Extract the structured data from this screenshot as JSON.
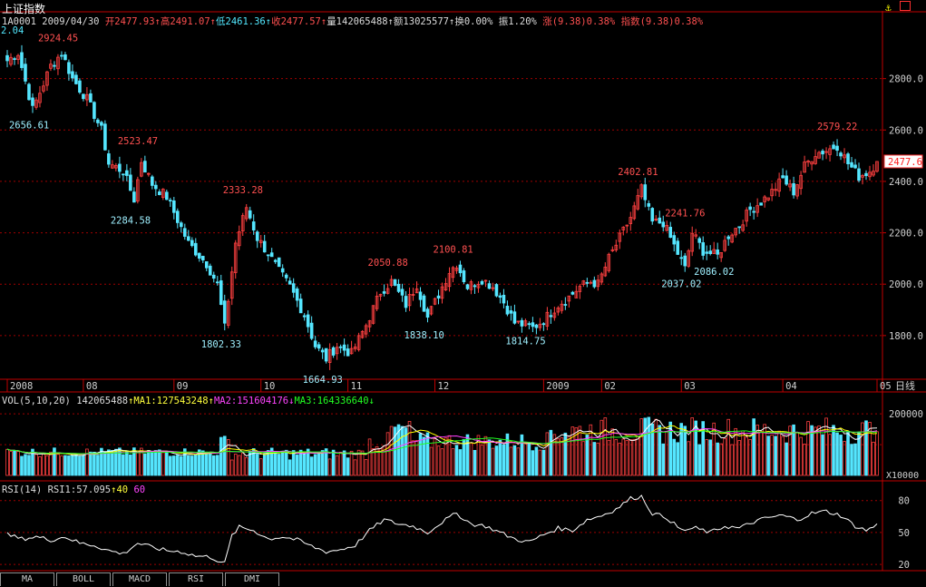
{
  "header": {
    "title": "上证指数",
    "code": "1A0001",
    "date": "2009/04/30",
    "open": "开2477.93",
    "high": "高2491.07",
    "low": "低2461.36",
    "close": "收2477.57",
    "volume": "量142065488",
    "amount": "额13025577",
    "turnover": "换0.00%",
    "amplitude": "振1.20%",
    "change": "涨(9.38)0.38%",
    "index_change": "指数(9.38)0.38%",
    "arrow_up": "↑",
    "arrow_down": "↓"
  },
  "colors": {
    "up": "#ff4040",
    "down": "#55e6ff",
    "grid": "#a00000",
    "frame": "#c00000",
    "ma1": "#ffffff",
    "ma2": "#ffff00",
    "ma3": "#ff40ff",
    "ma4": "#20ff20"
  },
  "volume_panel": {
    "label": "VOL(5,10,20)",
    "value": "142065488",
    "ma1": "MA1:127543248",
    "ma2": "MA2:151604176",
    "ma3": "MA3:164336640",
    "unit": "X10000"
  },
  "rsi_panel": {
    "label": "RSI(14)",
    "rsi1": "RSI1:57.095",
    "level_low": "40",
    "level_high": "60"
  },
  "tabs": [
    "MA",
    "BOLL",
    "MACD",
    "RSI",
    "DMI"
  ],
  "chart_data": {
    "type": "candlestick",
    "period_label": "日线",
    "last_price": "2477.6",
    "y_axis_ticks": [
      1800,
      2000,
      2200,
      2400,
      2600,
      2800
    ],
    "y_axis_labels": [
      "1800.0",
      "2000.0",
      "2200.0",
      "2400.0",
      "2600.0",
      "2800.0"
    ],
    "ylim": [
      1630,
      3000
    ],
    "x_axis_labels": [
      "2008",
      "08",
      "09",
      "10",
      "11",
      "12",
      "2009",
      "02",
      "03",
      "04",
      "05"
    ],
    "x_label_positions": [
      0,
      21,
      46,
      70,
      94,
      118,
      148,
      164,
      186,
      214,
      240
    ],
    "top_left_value": "2.04",
    "annotations": [
      {
        "text": "2924.45",
        "kind": "high",
        "idx": 15,
        "value": 2924.45
      },
      {
        "text": "2656.61",
        "kind": "low",
        "idx": 7,
        "value": 2656.61
      },
      {
        "text": "2523.47",
        "kind": "high",
        "idx": 37,
        "value": 2523.47
      },
      {
        "text": "2284.58",
        "kind": "low",
        "idx": 35,
        "value": 2284.58
      },
      {
        "text": "2333.28",
        "kind": "high",
        "idx": 66,
        "value": 2333.28
      },
      {
        "text": "1802.33",
        "kind": "low",
        "idx": 60,
        "value": 1802.33
      },
      {
        "text": "1664.93",
        "kind": "low",
        "idx": 88,
        "value": 1664.93
      },
      {
        "text": "2050.88",
        "kind": "high",
        "idx": 106,
        "value": 2050.88
      },
      {
        "text": "1838.10",
        "kind": "low",
        "idx": 116,
        "value": 1838.1
      },
      {
        "text": "2100.81",
        "kind": "high",
        "idx": 124,
        "value": 2100.81
      },
      {
        "text": "1814.75",
        "kind": "low",
        "idx": 144,
        "value": 1814.75
      },
      {
        "text": "2402.81",
        "kind": "high",
        "idx": 175,
        "value": 2402.81
      },
      {
        "text": "2241.76",
        "kind": "high",
        "idx": 188,
        "value": 2241.76
      },
      {
        "text": "2037.02",
        "kind": "low",
        "idx": 187,
        "value": 2037.02
      },
      {
        "text": "2086.02",
        "kind": "low",
        "idx": 196,
        "value": 2086.02
      },
      {
        "text": "2579.22",
        "kind": "high",
        "idx": 230,
        "value": 2579.22
      }
    ],
    "anchors": [
      [
        0,
        2870
      ],
      [
        3,
        2900
      ],
      [
        7,
        2680
      ],
      [
        10,
        2780
      ],
      [
        12,
        2850
      ],
      [
        15,
        2900
      ],
      [
        18,
        2800
      ],
      [
        22,
        2720
      ],
      [
        26,
        2600
      ],
      [
        28,
        2470
      ],
      [
        32,
        2440
      ],
      [
        35,
        2330
      ],
      [
        37,
        2480
      ],
      [
        40,
        2390
      ],
      [
        44,
        2340
      ],
      [
        50,
        2160
      ],
      [
        55,
        2080
      ],
      [
        58,
        2000
      ],
      [
        60,
        1830
      ],
      [
        63,
        2160
      ],
      [
        66,
        2300
      ],
      [
        69,
        2180
      ],
      [
        72,
        2120
      ],
      [
        75,
        2050
      ],
      [
        78,
        1990
      ],
      [
        82,
        1880
      ],
      [
        85,
        1760
      ],
      [
        88,
        1710
      ],
      [
        91,
        1760
      ],
      [
        95,
        1730
      ],
      [
        99,
        1840
      ],
      [
        103,
        1970
      ],
      [
        106,
        2010
      ],
      [
        110,
        1920
      ],
      [
        113,
        2000
      ],
      [
        116,
        1870
      ],
      [
        119,
        1960
      ],
      [
        122,
        2050
      ],
      [
        124,
        2080
      ],
      [
        127,
        1990
      ],
      [
        131,
        2020
      ],
      [
        134,
        1990
      ],
      [
        137,
        1930
      ],
      [
        140,
        1850
      ],
      [
        143,
        1840
      ],
      [
        145,
        1830
      ],
      [
        148,
        1860
      ],
      [
        152,
        1920
      ],
      [
        155,
        1950
      ],
      [
        158,
        1990
      ],
      [
        161,
        2010
      ],
      [
        163,
        2000
      ],
      [
        166,
        2100
      ],
      [
        169,
        2180
      ],
      [
        172,
        2260
      ],
      [
        175,
        2370
      ],
      [
        178,
        2240
      ],
      [
        181,
        2240
      ],
      [
        184,
        2150
      ],
      [
        187,
        2060
      ],
      [
        189,
        2200
      ],
      [
        192,
        2130
      ],
      [
        196,
        2110
      ],
      [
        199,
        2190
      ],
      [
        202,
        2230
      ],
      [
        205,
        2290
      ],
      [
        208,
        2320
      ],
      [
        211,
        2360
      ],
      [
        214,
        2410
      ],
      [
        217,
        2360
      ],
      [
        220,
        2460
      ],
      [
        223,
        2510
      ],
      [
        226,
        2520
      ],
      [
        229,
        2540
      ],
      [
        232,
        2470
      ],
      [
        235,
        2420
      ],
      [
        238,
        2440
      ],
      [
        240,
        2477
      ]
    ],
    "volume_ylim": [
      0,
      230000
    ],
    "volume_ticks": [
      100000,
      200000
    ],
    "volume_tick_labels": [
      "",
      "200000"
    ],
    "rsi_ylim": [
      15,
      90
    ],
    "rsi_ticks": [
      20,
      50,
      80
    ],
    "rsi_anchors": [
      [
        0,
        48
      ],
      [
        4,
        44
      ],
      [
        8,
        46
      ],
      [
        12,
        43
      ],
      [
        16,
        46
      ],
      [
        20,
        40
      ],
      [
        24,
        38
      ],
      [
        28,
        33
      ],
      [
        32,
        30
      ],
      [
        36,
        40
      ],
      [
        40,
        36
      ],
      [
        44,
        33
      ],
      [
        48,
        32
      ],
      [
        52,
        28
      ],
      [
        56,
        27
      ],
      [
        60,
        21
      ],
      [
        62,
        47
      ],
      [
        64,
        55
      ],
      [
        68,
        52
      ],
      [
        72,
        44
      ],
      [
        76,
        46
      ],
      [
        80,
        43
      ],
      [
        84,
        37
      ],
      [
        88,
        32
      ],
      [
        92,
        34
      ],
      [
        96,
        38
      ],
      [
        100,
        52
      ],
      [
        104,
        62
      ],
      [
        108,
        58
      ],
      [
        112,
        56
      ],
      [
        116,
        50
      ],
      [
        120,
        60
      ],
      [
        124,
        68
      ],
      [
        128,
        58
      ],
      [
        132,
        56
      ],
      [
        136,
        50
      ],
      [
        140,
        44
      ],
      [
        144,
        41
      ],
      [
        148,
        48
      ],
      [
        152,
        54
      ],
      [
        156,
        52
      ],
      [
        160,
        62
      ],
      [
        164,
        66
      ],
      [
        168,
        72
      ],
      [
        172,
        82
      ],
      [
        175,
        84
      ],
      [
        178,
        68
      ],
      [
        182,
        64
      ],
      [
        186,
        52
      ],
      [
        190,
        54
      ],
      [
        194,
        50
      ],
      [
        198,
        56
      ],
      [
        202,
        54
      ],
      [
        206,
        60
      ],
      [
        210,
        64
      ],
      [
        214,
        66
      ],
      [
        218,
        62
      ],
      [
        222,
        68
      ],
      [
        226,
        70
      ],
      [
        230,
        66
      ],
      [
        234,
        56
      ],
      [
        237,
        52
      ],
      [
        240,
        57
      ]
    ]
  }
}
